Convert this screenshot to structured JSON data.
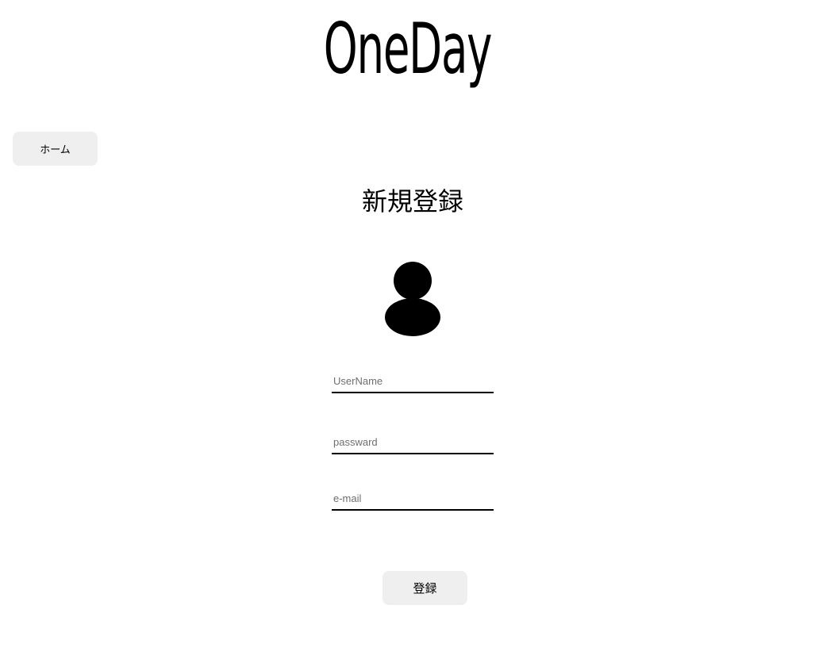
{
  "header": {
    "logo_text": "OneDay"
  },
  "nav": {
    "home_label": "ホーム"
  },
  "form": {
    "title": "新規登録",
    "avatar_icon": "user-silhouette-icon",
    "username_placeholder": "UserName",
    "username_value": "",
    "password_placeholder": "passward",
    "password_value": "",
    "email_placeholder": "e-mail",
    "email_value": "",
    "submit_label": "登録"
  }
}
